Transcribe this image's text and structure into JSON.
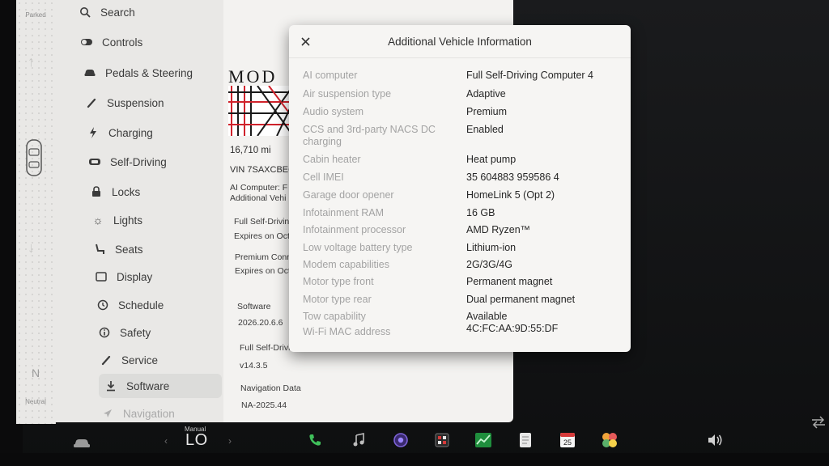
{
  "drive": {
    "top_label": "Parked",
    "gear": "N",
    "bottom_label": "Neutral"
  },
  "menu": {
    "items": [
      {
        "label": "Search",
        "icon": "search-icon"
      },
      {
        "label": "Controls",
        "icon": "toggle-icon"
      },
      {
        "label": "Pedals & Steering",
        "icon": "car-icon"
      },
      {
        "label": "Suspension",
        "icon": "wrench-icon"
      },
      {
        "label": "Charging",
        "icon": "bolt-icon"
      },
      {
        "label": "Self-Driving",
        "icon": "steering-wheel-icon"
      },
      {
        "label": "Locks",
        "icon": "lock-icon"
      },
      {
        "label": "Lights",
        "icon": "sun-icon"
      },
      {
        "label": "Seats",
        "icon": "seat-icon"
      },
      {
        "label": "Display",
        "icon": "display-icon"
      },
      {
        "label": "Schedule",
        "icon": "clock-icon"
      },
      {
        "label": "Safety",
        "icon": "info-icon"
      },
      {
        "label": "Service",
        "icon": "wrench-icon"
      },
      {
        "label": "Software",
        "icon": "download-icon"
      },
      {
        "label": "Navigation",
        "icon": "navigation-icon"
      }
    ]
  },
  "detail": {
    "model_word": "MOD",
    "odometer": "16,710 mi",
    "vin": "VIN 7SAXCBE6",
    "ai_computer": "AI Computer: F",
    "additional_link": "Additional Vehi",
    "fsd_title": "Full Self-Drivin",
    "fsd_expires": "Expires on Oct",
    "premium_title": "Premium Conn",
    "premium_expires": "Expires on Oct",
    "software_label": "Software",
    "software_version": "2026.20.6.6",
    "fsd_label": "Full Self-Drivin",
    "fsd_version": "v14.3.5",
    "nav_label": "Navigation Data",
    "nav_version": "NA-2025.44"
  },
  "modal": {
    "title": "Additional Vehicle Information",
    "rows": [
      {
        "label": "AI computer",
        "value": "Full Self-Driving Computer 4"
      },
      {
        "label": "Air suspension type",
        "value": "Adaptive"
      },
      {
        "label": "Audio system",
        "value": "Premium"
      },
      {
        "label": "CCS and 3rd-party NACS DC charging",
        "value": "Enabled"
      },
      {
        "label": "Cabin heater",
        "value": "Heat pump"
      },
      {
        "label": "Cell IMEI",
        "value": "35 604883 959586 4"
      },
      {
        "label": "Garage door opener",
        "value": "HomeLink 5 (Opt 2)"
      },
      {
        "label": "Infotainment RAM",
        "value": "16 GB"
      },
      {
        "label": "Infotainment processor",
        "value": "AMD Ryzen™"
      },
      {
        "label": "Low voltage battery type",
        "value": "Lithium-ion"
      },
      {
        "label": "Modem capabilities",
        "value": "2G/3G/4G"
      },
      {
        "label": "Motor type front",
        "value": "Permanent magnet"
      },
      {
        "label": "Motor type rear",
        "value": "Dual permanent magnet"
      },
      {
        "label": "Tow capability",
        "value": "Available"
      },
      {
        "label": "Wi-Fi MAC address",
        "value": "4C:FC:AA:9D:55:DF"
      }
    ]
  },
  "taskbar": {
    "temp_mode": "Manual",
    "temp_value": "LO",
    "calendar_day": "25",
    "icons": [
      "car-icon",
      "phone-icon",
      "music-icon",
      "camera-icon",
      "dashcam-icon",
      "chart-icon",
      "notes-icon",
      "calendar-icon",
      "apps-icon",
      "volume-icon",
      "swap-icon"
    ]
  },
  "colors": {
    "accent_link": "#2a59d6",
    "phone_green": "#3fbf5a"
  }
}
